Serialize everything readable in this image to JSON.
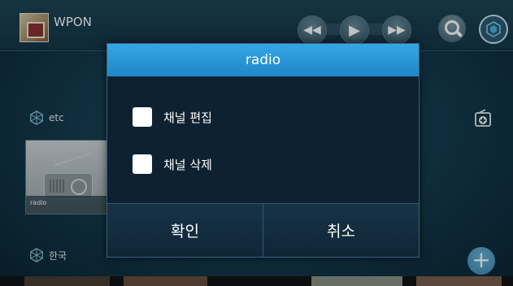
{
  "topbar": {
    "app_title": "WPON",
    "media_controls": [
      "rewind-icon",
      "play-icon",
      "fast-forward-icon"
    ],
    "search_icon": "search-icon",
    "globe_icon": "globe-icon"
  },
  "sections": [
    {
      "label": "etc",
      "icon": "globe-icon"
    },
    {
      "label": "한국",
      "icon": "globe-icon"
    }
  ],
  "thumbnail": {
    "label": "radio",
    "icon": "radio-icon"
  },
  "add_channel_icon": "radio-add-icon",
  "fab_label": "+",
  "dialog": {
    "title": "radio",
    "options": [
      "채널 편집",
      "채널 삭제"
    ],
    "confirm_label": "확인",
    "cancel_label": "취소"
  },
  "colors": {
    "accent": "#2a9be0",
    "dialog_bg": "#0f2331",
    "fab": "#4a9ccb"
  }
}
